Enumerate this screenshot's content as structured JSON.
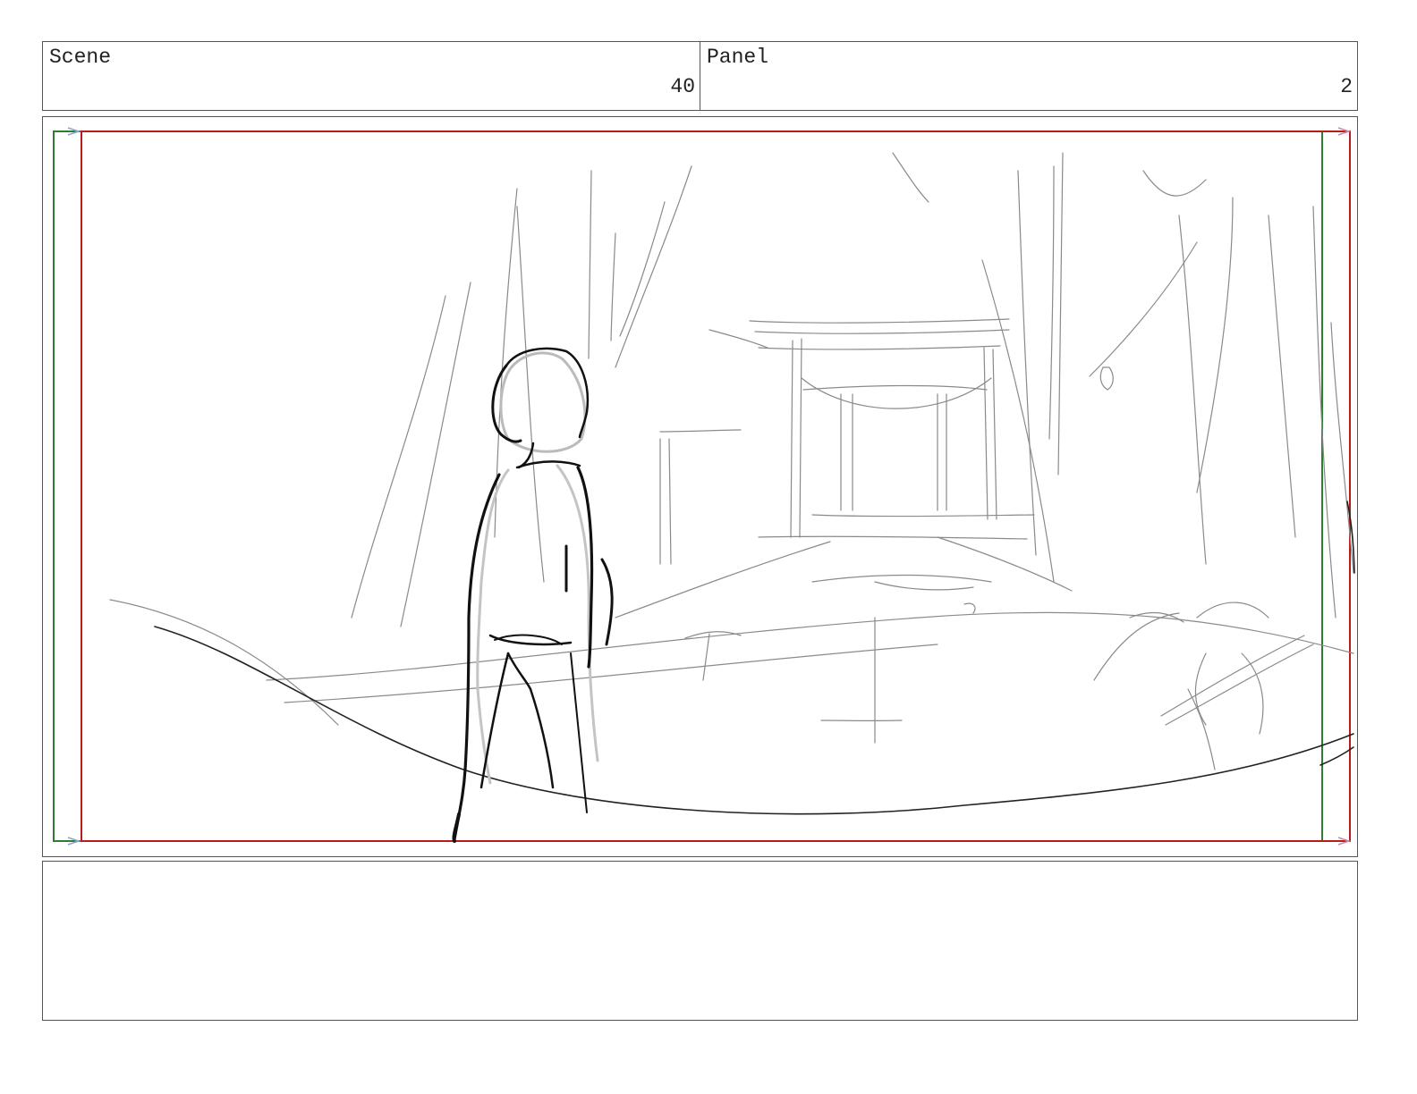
{
  "header": {
    "scene_label": "Scene",
    "scene_number": "40",
    "panel_label": "Panel",
    "panel_number": "2"
  },
  "panel": {
    "safe_frame_color": "#2e7d32",
    "action_frame_color": "#b71c1c",
    "sketch_color": "#111111"
  },
  "notes": {
    "text": ""
  }
}
